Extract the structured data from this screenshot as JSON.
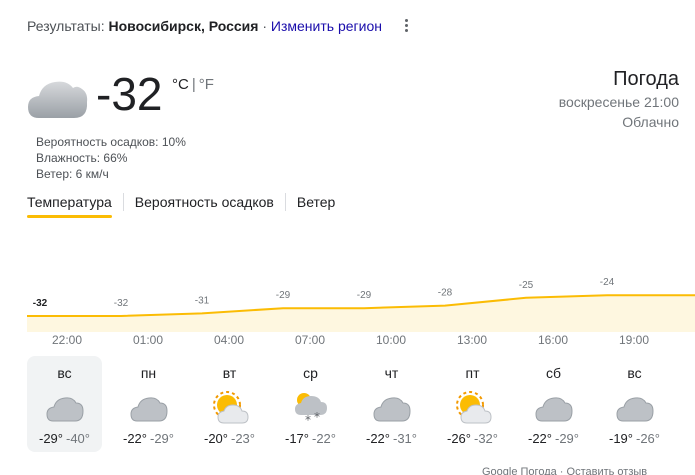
{
  "header": {
    "results_prefix": "Результаты:",
    "location": "Новосибирск, Россия",
    "separator": "·",
    "change_region": "Изменить регион"
  },
  "current": {
    "temperature": "-32",
    "unit_c": "°C",
    "unit_sep": "|",
    "unit_f": "°F",
    "icon": "cloud-icon",
    "details": [
      "Вероятность осадков: 10%",
      "Влажность: 66%",
      "Ветер: 6 км/ч"
    ]
  },
  "summary": {
    "title": "Погода",
    "datetime": "воскресенье 21:00",
    "condition": "Облачно"
  },
  "tabs": [
    {
      "label": "Температура",
      "active": true
    },
    {
      "label": "Вероятность осадков",
      "active": false
    },
    {
      "label": "Ветер",
      "active": false
    }
  ],
  "chart_data": {
    "type": "area",
    "x": [
      "22:00",
      "01:00",
      "04:00",
      "07:00",
      "10:00",
      "13:00",
      "16:00",
      "19:00"
    ],
    "values": [
      -32,
      -32,
      -31,
      -29,
      -29,
      -28,
      -25,
      -24
    ],
    "line_color": "#fbbc04",
    "fill_color": "#fef7e0"
  },
  "forecast": [
    {
      "day": "вс",
      "icon": "cloud-icon",
      "hi": "-29°",
      "lo": "-40°",
      "selected": true
    },
    {
      "day": "пн",
      "icon": "cloud-icon",
      "hi": "-22°",
      "lo": "-29°"
    },
    {
      "day": "вт",
      "icon": "partly-sunny-icon",
      "hi": "-20°",
      "lo": "-23°"
    },
    {
      "day": "ср",
      "icon": "snow-icon",
      "hi": "-17°",
      "lo": "-22°"
    },
    {
      "day": "чт",
      "icon": "cloud-icon",
      "hi": "-22°",
      "lo": "-31°"
    },
    {
      "day": "пт",
      "icon": "partly-sunny-icon",
      "hi": "-26°",
      "lo": "-32°"
    },
    {
      "day": "сб",
      "icon": "cloud-icon",
      "hi": "-22°",
      "lo": "-29°"
    },
    {
      "day": "вс",
      "icon": "cloud-icon",
      "hi": "-19°",
      "lo": "-26°"
    }
  ],
  "footer": {
    "source": "Google Погода",
    "separator": "·",
    "feedback": "Оставить отзыв"
  }
}
